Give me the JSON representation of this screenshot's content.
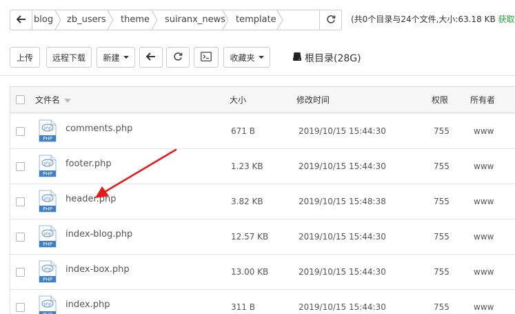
{
  "breadcrumb": {
    "items": [
      "blog",
      "zb_users",
      "theme",
      "suiranx_news",
      "template"
    ]
  },
  "summary": {
    "text": "(共0个目录与24个文件,大小:63.18 KB",
    "link": "获取)"
  },
  "toolbar": {
    "upload": "上传",
    "remote_download": "远程下载",
    "new": "新建",
    "favorites": "收藏夹",
    "root_dir": "根目录(28G)"
  },
  "table": {
    "columns": {
      "name": "文件名",
      "size": "大小",
      "modified": "修改时间",
      "permission": "权限",
      "owner": "所有者"
    },
    "file_icon_label": "PHP",
    "rows": [
      {
        "name": "comments.php",
        "size": "671 B",
        "modified": "2019/10/15 15:44:30",
        "permission": "755",
        "owner": "www"
      },
      {
        "name": "footer.php",
        "size": "1.23 KB",
        "modified": "2019/10/15 15:44:30",
        "permission": "755",
        "owner": "www"
      },
      {
        "name": "header.php",
        "size": "3.82 KB",
        "modified": "2019/10/15 15:48:38",
        "permission": "755",
        "owner": "www"
      },
      {
        "name": "index-blog.php",
        "size": "12.57 KB",
        "modified": "2019/10/15 15:44:30",
        "permission": "755",
        "owner": "www"
      },
      {
        "name": "index-box.php",
        "size": "13.00 KB",
        "modified": "2019/10/15 15:44:30",
        "permission": "755",
        "owner": "www"
      },
      {
        "name": "index.php",
        "size": "311 B",
        "modified": "2019/10/15 15:44:30",
        "permission": "755",
        "owner": "www"
      }
    ]
  },
  "colors": {
    "accent_green": "#20a53a",
    "annotation_arrow": "#e8191a",
    "php_icon_blue": "#3f7fc7"
  }
}
